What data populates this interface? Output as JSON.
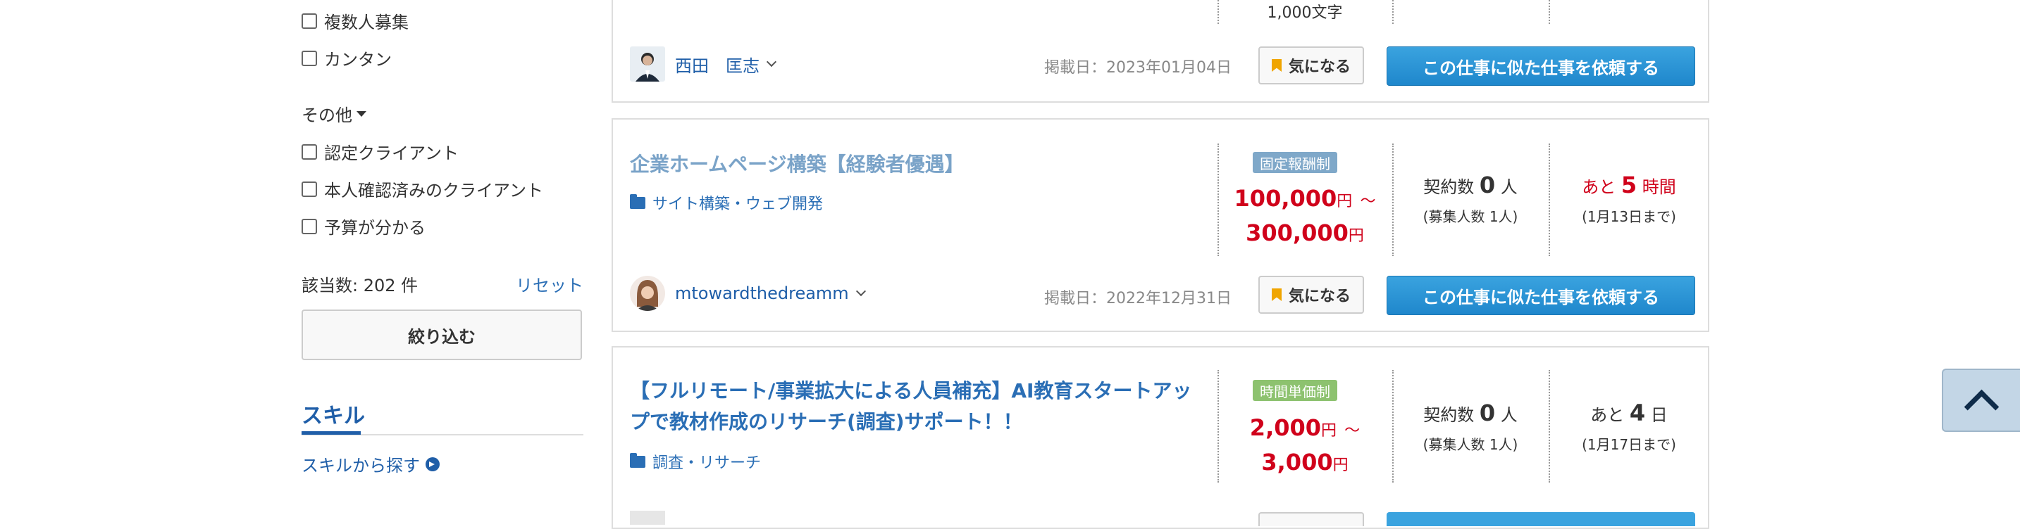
{
  "sidebar": {
    "checkboxes_top": [
      {
        "label": "複数人募集"
      },
      {
        "label": "カンタン"
      }
    ],
    "other_section_label": "その他",
    "checkboxes_other": [
      {
        "label": "認定クライアント"
      },
      {
        "label": "本人確認済みのクライアント"
      },
      {
        "label": "予算が分かる"
      }
    ],
    "count_text": "該当数: 202 件",
    "reset_label": "リセット",
    "narrow_button_label": "絞り込む",
    "skill_tab_label": "スキル",
    "skill_link_label": "スキルから探す"
  },
  "jobs": [
    {
      "partial_text": "1,000文字",
      "user": "西田　匡志",
      "posted": "掲載日：2023年01月04日",
      "fav_label": "気になる",
      "request_label": "この仕事に似た仕事を依頼する"
    },
    {
      "title": "企業ホームページ構築【経験者優遇】",
      "category": "サイト構築・ウェブ開発",
      "badge": "固定報酬制",
      "price_from": "100,000",
      "price_to": "300,000",
      "currency": "円",
      "range_mark": "～",
      "contracts_label": "契約数",
      "contracts_value": "0",
      "contracts_unit": "人",
      "recruit_text": "(募集人数 1人)",
      "remain_prefix": "あと",
      "remain_value": "5",
      "remain_unit": "時間",
      "deadline_text": "(1月13日まで)",
      "user": "mtowardthedreamm",
      "posted": "掲載日：2022年12月31日",
      "fav_label": "気になる",
      "request_label": "この仕事に似た仕事を依頼する"
    },
    {
      "title_line1": "【フルリモート/事業拡大による人員補充】AI教育スタートアッ",
      "title_line2": "プで教材作成のリサーチ(調査)サポート！！",
      "category": "調査・リサーチ",
      "badge": "時間単価制",
      "price_from": "2,000",
      "price_to": "3,000",
      "currency": "円",
      "range_mark": "～",
      "contracts_label": "契約数",
      "contracts_value": "0",
      "contracts_unit": "人",
      "recruit_text": "(募集人数 1人)",
      "remain_prefix": "あと",
      "remain_value": "4",
      "remain_unit": "日",
      "deadline_text": "(1月17日まで)"
    }
  ],
  "colors": {
    "link_blue": "#2a6eb5",
    "price_red": "#d0021b",
    "badge_fixed": "#7fa8c9",
    "badge_hourly": "#8dc26f",
    "button_blue": "#2a97d8"
  },
  "icons": [
    "folder-icon",
    "bookmark-icon",
    "chevron-down-icon",
    "arrow-circle-right-icon",
    "chevron-up-icon"
  ]
}
